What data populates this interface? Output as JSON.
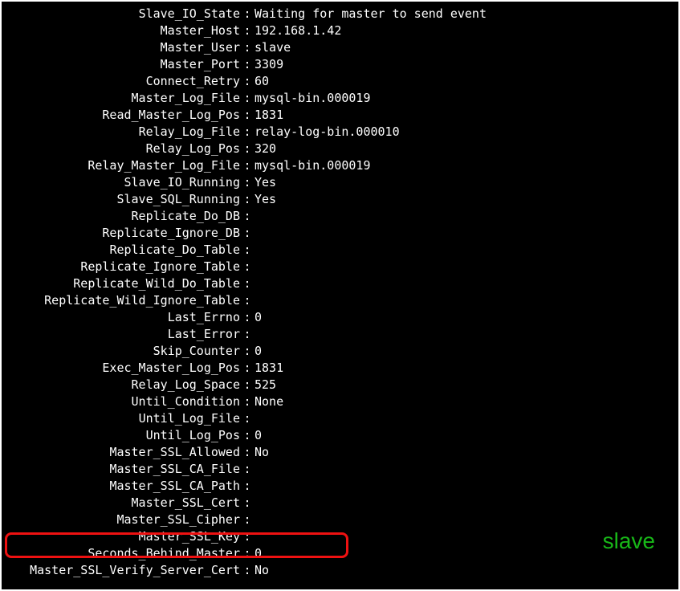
{
  "label": "slave",
  "status": [
    {
      "key": "Slave_IO_State",
      "value": "Waiting for master to send event"
    },
    {
      "key": "Master_Host",
      "value": "192.168.1.42"
    },
    {
      "key": "Master_User",
      "value": "slave"
    },
    {
      "key": "Master_Port",
      "value": "3309"
    },
    {
      "key": "Connect_Retry",
      "value": "60"
    },
    {
      "key": "Master_Log_File",
      "value": "mysql-bin.000019"
    },
    {
      "key": "Read_Master_Log_Pos",
      "value": "1831"
    },
    {
      "key": "Relay_Log_File",
      "value": "relay-log-bin.000010"
    },
    {
      "key": "Relay_Log_Pos",
      "value": "320"
    },
    {
      "key": "Relay_Master_Log_File",
      "value": "mysql-bin.000019"
    },
    {
      "key": "Slave_IO_Running",
      "value": "Yes"
    },
    {
      "key": "Slave_SQL_Running",
      "value": "Yes"
    },
    {
      "key": "Replicate_Do_DB",
      "value": ""
    },
    {
      "key": "Replicate_Ignore_DB",
      "value": ""
    },
    {
      "key": "Replicate_Do_Table",
      "value": ""
    },
    {
      "key": "Replicate_Ignore_Table",
      "value": ""
    },
    {
      "key": "Replicate_Wild_Do_Table",
      "value": ""
    },
    {
      "key": "Replicate_Wild_Ignore_Table",
      "value": ""
    },
    {
      "key": "Last_Errno",
      "value": "0"
    },
    {
      "key": "Last_Error",
      "value": ""
    },
    {
      "key": "Skip_Counter",
      "value": "0"
    },
    {
      "key": "Exec_Master_Log_Pos",
      "value": "1831"
    },
    {
      "key": "Relay_Log_Space",
      "value": "525"
    },
    {
      "key": "Until_Condition",
      "value": "None"
    },
    {
      "key": "Until_Log_File",
      "value": ""
    },
    {
      "key": "Until_Log_Pos",
      "value": "0"
    },
    {
      "key": "Master_SSL_Allowed",
      "value": "No"
    },
    {
      "key": "Master_SSL_CA_File",
      "value": ""
    },
    {
      "key": "Master_SSL_CA_Path",
      "value": ""
    },
    {
      "key": "Master_SSL_Cert",
      "value": ""
    },
    {
      "key": "Master_SSL_Cipher",
      "value": ""
    },
    {
      "key": "Master_SSL_Key",
      "value": ""
    },
    {
      "key": "Seconds_Behind_Master",
      "value": "0"
    },
    {
      "key": "Master_SSL_Verify_Server_Cert",
      "value": "No"
    }
  ]
}
